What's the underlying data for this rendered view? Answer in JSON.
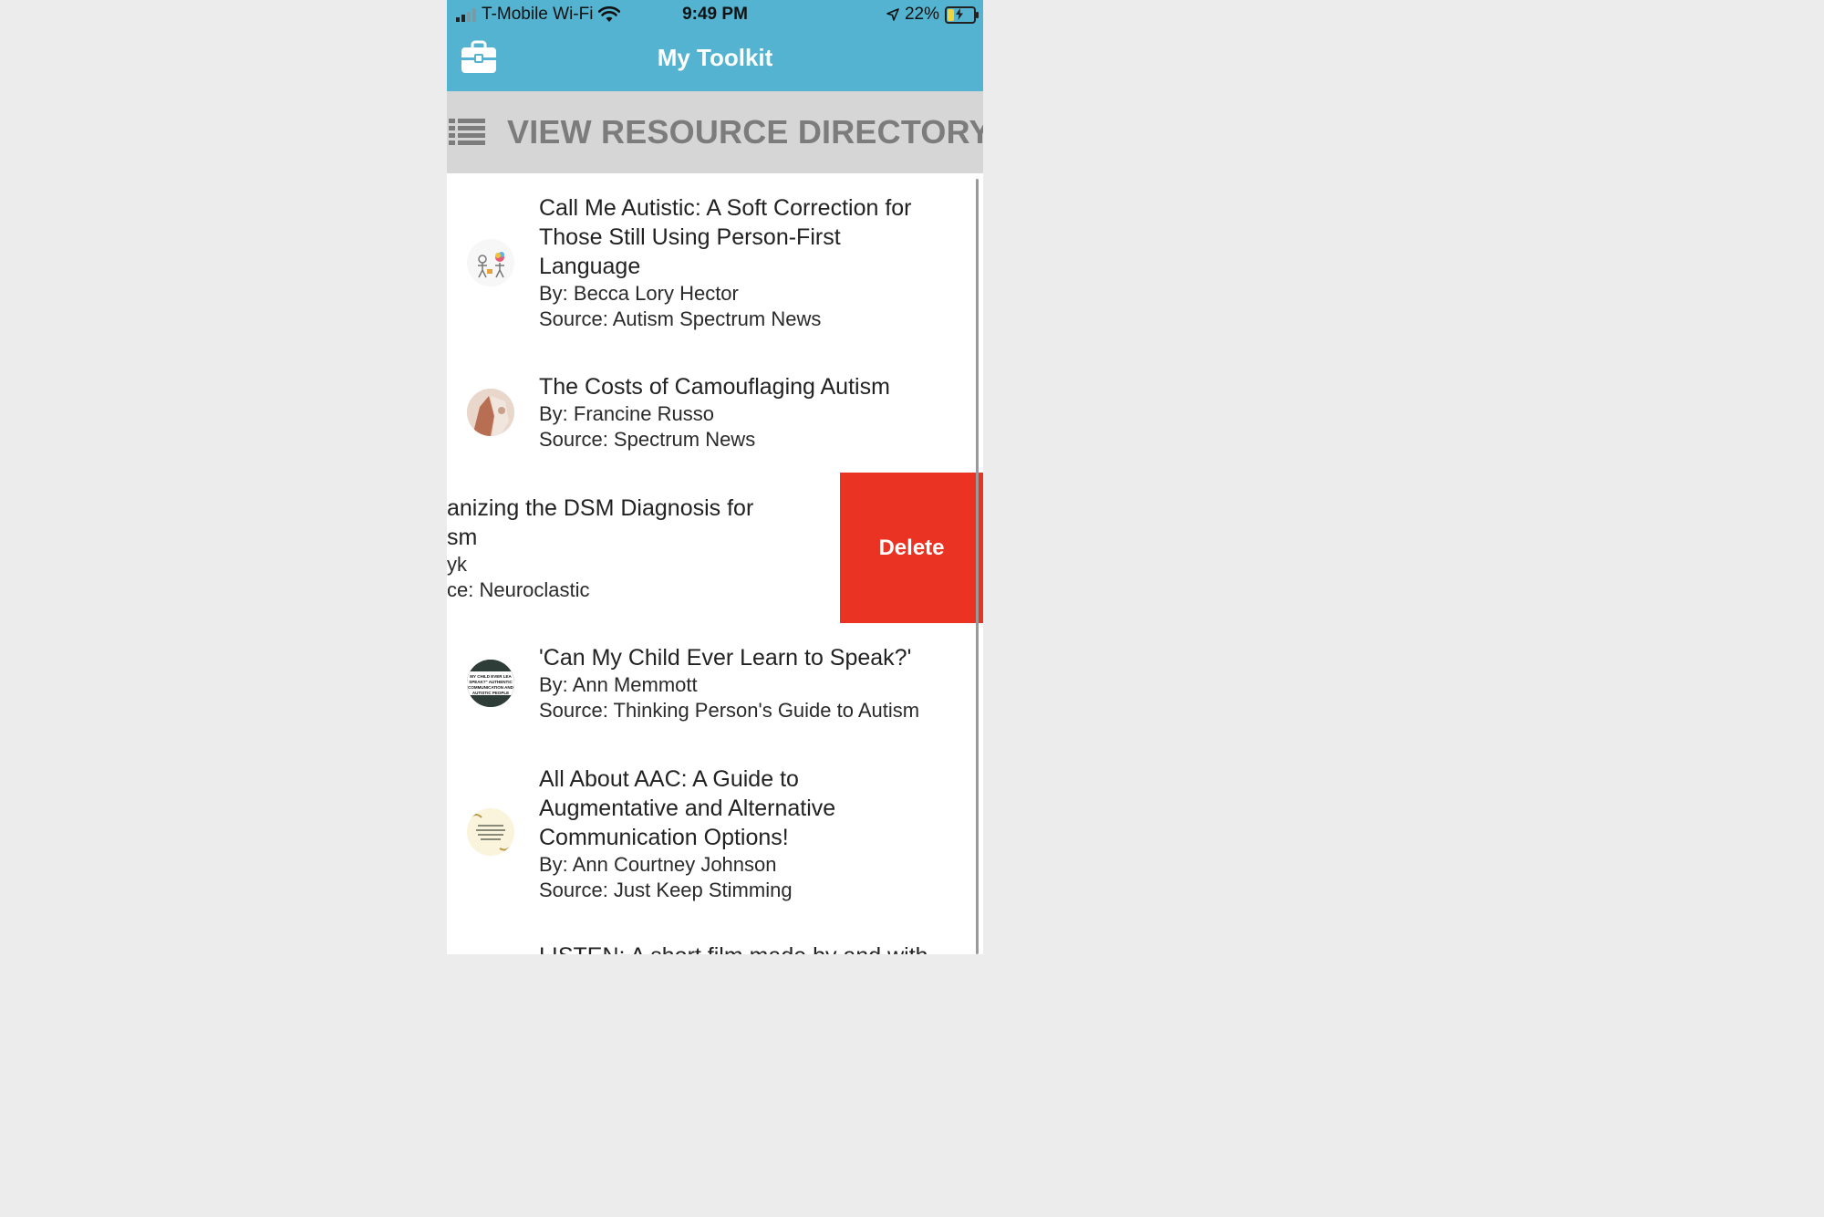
{
  "status_bar": {
    "carrier": "T-Mobile Wi-Fi",
    "time": "9:49 PM",
    "battery": "22%"
  },
  "app_bar": {
    "title": "My Toolkit",
    "left_icon": "toolkit-icon"
  },
  "directory_bar": {
    "label": "VIEW RESOURCE DIRECTORY",
    "icon": "list-icon"
  },
  "resources": [
    {
      "title_lines": [
        "Call Me Autistic: A Soft Correction for",
        "Those Still Using Person-First",
        "Language"
      ],
      "author": "By: Becca Lory Hector",
      "source": "Source: Autism Spectrum News"
    },
    {
      "title_lines": [
        "The Costs of Camouflaging Autism"
      ],
      "author": "By: Francine Russo",
      "source": "Source: Spectrum News"
    },
    {
      "title_lines": [
        "anizing the DSM Diagnosis for",
        "sm"
      ],
      "author": "yk",
      "source": "ce: Neuroclastic"
    },
    {
      "title_lines": [
        "'Can My Child Ever Learn to Speak?'"
      ],
      "author": "By: Ann Memmott",
      "source": "Source: Thinking Person's Guide to Autism"
    },
    {
      "title_lines": [
        "All About AAC: A Guide to",
        "Augmentative and Alternative",
        "Communication Options!"
      ],
      "author": "By: Ann Courtney Johnson",
      "source": "Source: Just Keep Stimming"
    },
    {
      "title_lines": [
        "LISTEN: A short film made by and with"
      ]
    }
  ],
  "thumbnail_texts": {
    "speak": [
      "MY CHILD EVER LEA",
      "SPEAK?\" AUTHENTIC",
      "COMMUNICATION AND",
      "AUTISTIC PEOPLE"
    ]
  },
  "swipe_action": {
    "label": "Delete",
    "color": "#ea3323"
  },
  "colors": {
    "app_bar": "#54b3d0",
    "directory_bar": "#d6d6d6",
    "directory_text": "#7c7c7c"
  }
}
